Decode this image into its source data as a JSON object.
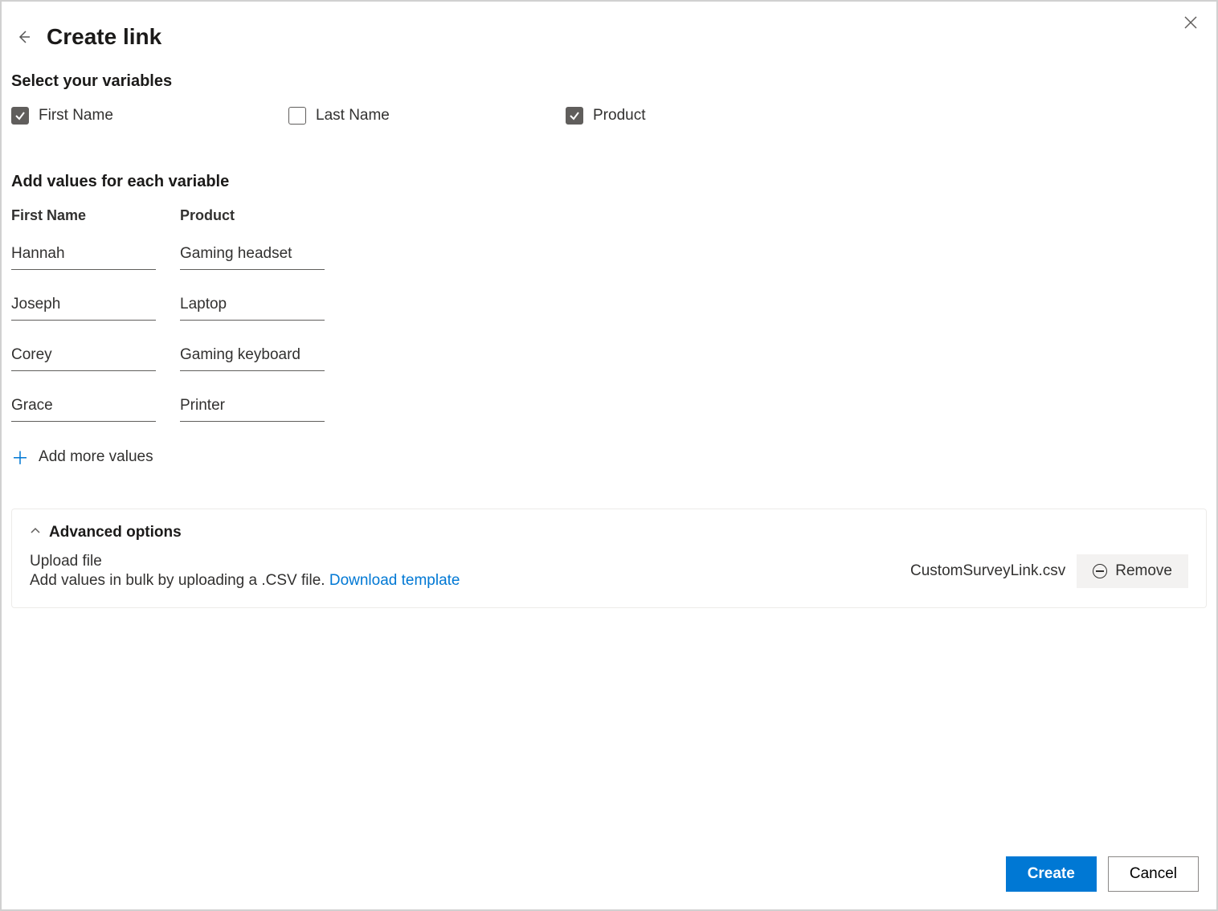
{
  "header": {
    "title": "Create link"
  },
  "variables": {
    "section_label": "Select your variables",
    "options": [
      {
        "label": "First Name",
        "checked": true
      },
      {
        "label": "Last Name",
        "checked": false
      },
      {
        "label": "Product",
        "checked": true
      }
    ]
  },
  "values_section": {
    "label": "Add values for each variable",
    "columns": [
      "First Name",
      "Product"
    ],
    "rows": [
      {
        "first_name": "Hannah",
        "product": "Gaming headset"
      },
      {
        "first_name": "Joseph",
        "product": "Laptop"
      },
      {
        "first_name": "Corey",
        "product": "Gaming keyboard"
      },
      {
        "first_name": "Grace",
        "product": "Printer"
      }
    ],
    "add_more_label": "Add more values"
  },
  "advanced": {
    "title": "Advanced options",
    "upload_label": "Upload file",
    "upload_desc_prefix": "Add values in bulk by uploading a .CSV file. ",
    "download_template_label": "Download template",
    "file_name": "CustomSurveyLink.csv",
    "remove_label": "Remove"
  },
  "footer": {
    "create_label": "Create",
    "cancel_label": "Cancel"
  }
}
